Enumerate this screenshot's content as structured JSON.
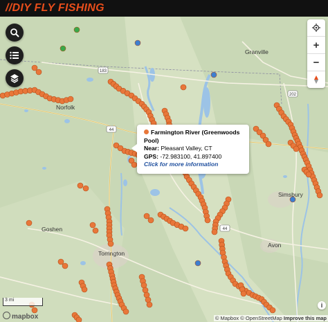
{
  "app": {
    "title": "//DIY FLY FISHING"
  },
  "controls": {
    "search": "search-icon",
    "list": "list-icon",
    "layers": "layers-icon",
    "locate": "locate-icon",
    "zoom_in": "+",
    "zoom_out": "−",
    "compass": "compass-icon"
  },
  "popup": {
    "name": "Farmington River (Greenwoods Pool)",
    "near_label": "Near:",
    "near_value": "Pleasant Valley, CT",
    "gps_label": "GPS:",
    "gps_value": "-72.983100, 41.897400",
    "link": "Click for more information"
  },
  "towns": [
    "Granville",
    "Norfolk",
    "Simsbury",
    "Goshen",
    "Torrington",
    "Avon"
  ],
  "routes": [
    "183",
    "44",
    "202",
    "44"
  ],
  "scale_label": "3 mi",
  "attribution": {
    "mapbox": "© Mapbox",
    "osm": "© OpenStreetMap",
    "improve": "Improve this map"
  },
  "logo": "mapbox",
  "colors": {
    "spot_orange": "#e8773a",
    "spot_blue": "#3d7fd0",
    "spot_green": "#3aa84a",
    "water": "#9cc3e6",
    "land": "#c9d8b6",
    "title_red": "#e84e1b",
    "bar_black": "#111111"
  }
}
